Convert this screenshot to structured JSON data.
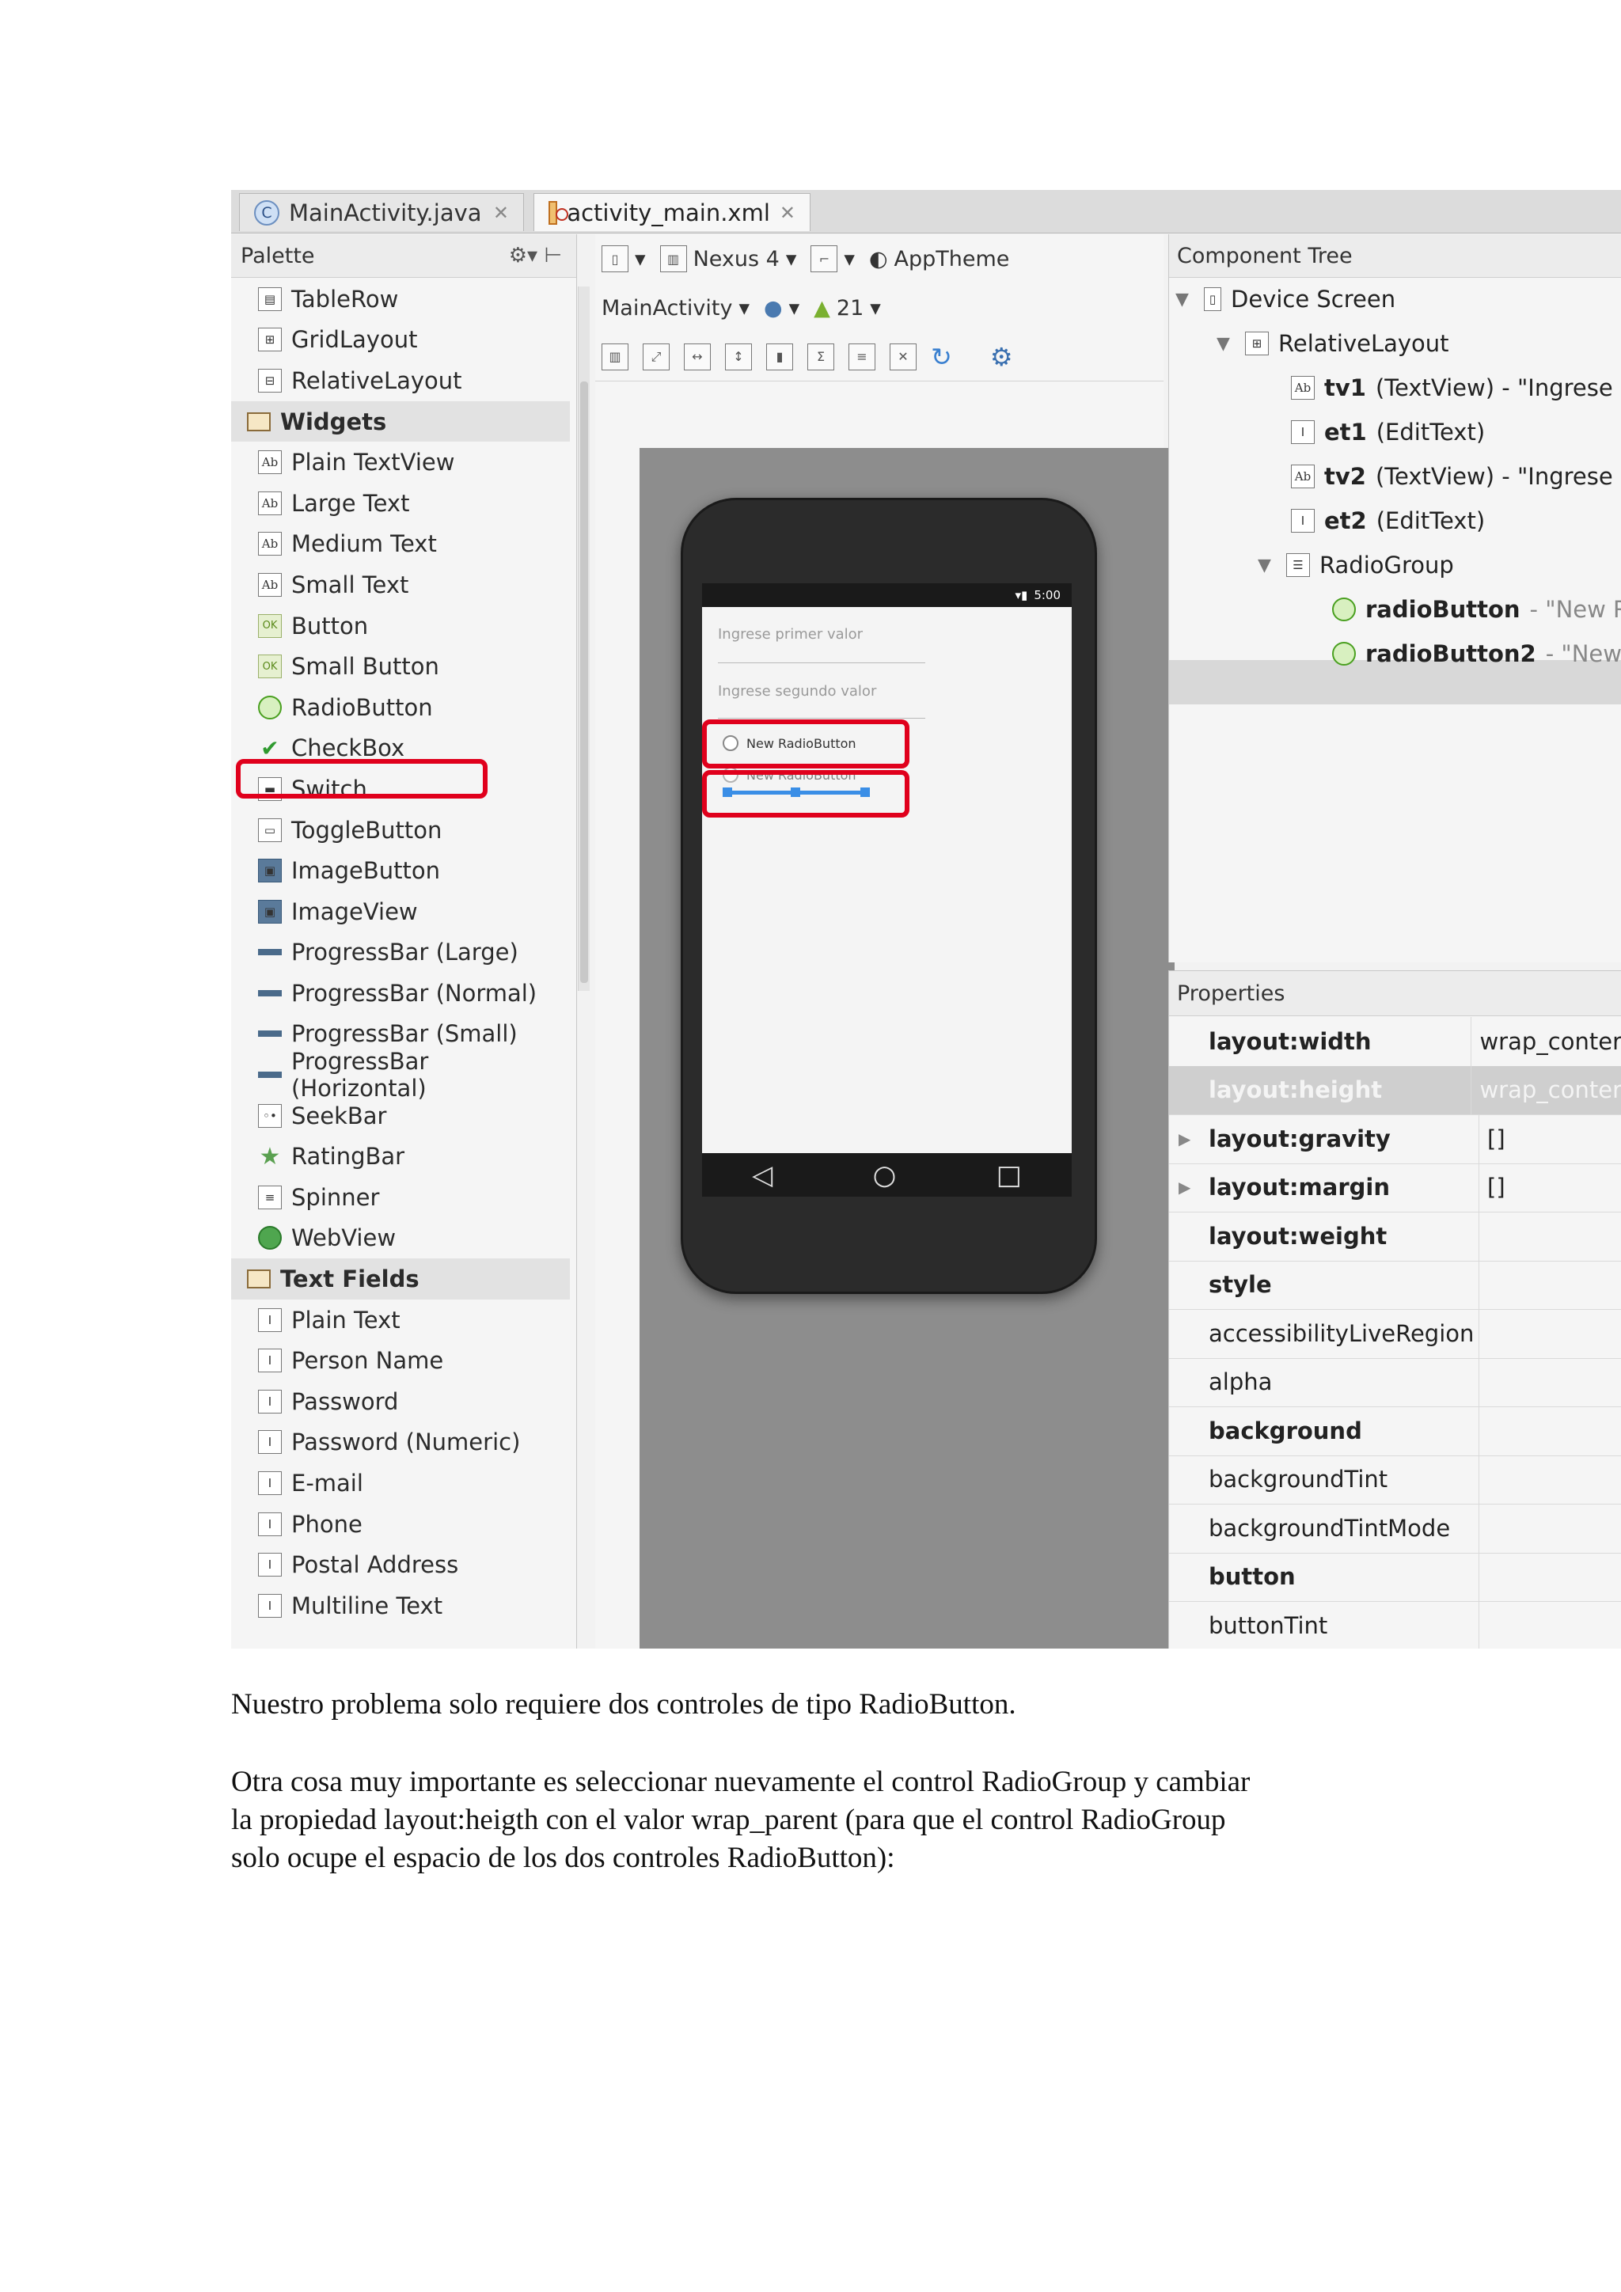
{
  "tabs": [
    {
      "label": "MainActivity.java",
      "icon": "java-class-icon"
    },
    {
      "label": "activity_main.xml",
      "icon": "xml-layout-icon"
    }
  ],
  "palette": {
    "title": "Palette",
    "items": [
      {
        "label": "TableRow",
        "icon": "table-row-icon",
        "kind": "item"
      },
      {
        "label": "GridLayout",
        "icon": "grid-layout-icon",
        "kind": "item"
      },
      {
        "label": "RelativeLayout",
        "icon": "relative-layout-icon",
        "kind": "item"
      },
      {
        "label": "Widgets",
        "icon": "folder-icon",
        "kind": "category"
      },
      {
        "label": "Plain TextView",
        "icon": "textview-icon",
        "kind": "item"
      },
      {
        "label": "Large Text",
        "icon": "textview-icon",
        "kind": "item"
      },
      {
        "label": "Medium Text",
        "icon": "textview-icon",
        "kind": "item"
      },
      {
        "label": "Small Text",
        "icon": "textview-icon",
        "kind": "item"
      },
      {
        "label": "Button",
        "icon": "button-icon",
        "kind": "item"
      },
      {
        "label": "Small Button",
        "icon": "button-icon",
        "kind": "item"
      },
      {
        "label": "RadioButton",
        "icon": "radio-button-icon",
        "kind": "item"
      },
      {
        "label": "CheckBox",
        "icon": "checkbox-icon",
        "kind": "item"
      },
      {
        "label": "Switch",
        "icon": "switch-icon",
        "kind": "item"
      },
      {
        "label": "ToggleButton",
        "icon": "toggle-button-icon",
        "kind": "item"
      },
      {
        "label": "ImageButton",
        "icon": "image-button-icon",
        "kind": "item"
      },
      {
        "label": "ImageView",
        "icon": "image-view-icon",
        "kind": "item"
      },
      {
        "label": "ProgressBar (Large)",
        "icon": "progress-bar-icon",
        "kind": "item"
      },
      {
        "label": "ProgressBar (Normal)",
        "icon": "progress-bar-icon",
        "kind": "item"
      },
      {
        "label": "ProgressBar (Small)",
        "icon": "progress-bar-icon",
        "kind": "item"
      },
      {
        "label": "ProgressBar (Horizontal)",
        "icon": "progress-bar-icon",
        "kind": "item"
      },
      {
        "label": "SeekBar",
        "icon": "seekbar-icon",
        "kind": "item"
      },
      {
        "label": "RatingBar",
        "icon": "star-icon",
        "kind": "item"
      },
      {
        "label": "Spinner",
        "icon": "spinner-icon",
        "kind": "item"
      },
      {
        "label": "WebView",
        "icon": "globe-icon",
        "kind": "item"
      },
      {
        "label": "Text Fields",
        "icon": "folder-icon",
        "kind": "category"
      },
      {
        "label": "Plain Text",
        "icon": "edittext-icon",
        "kind": "item"
      },
      {
        "label": "Person Name",
        "icon": "edittext-icon",
        "kind": "item"
      },
      {
        "label": "Password",
        "icon": "edittext-icon",
        "kind": "item"
      },
      {
        "label": "Password (Numeric)",
        "icon": "edittext-icon",
        "kind": "item"
      },
      {
        "label": "E-mail",
        "icon": "edittext-icon",
        "kind": "item"
      },
      {
        "label": "Phone",
        "icon": "edittext-icon",
        "kind": "item"
      },
      {
        "label": "Postal Address",
        "icon": "edittext-icon",
        "kind": "item"
      },
      {
        "label": "Multiline Text",
        "icon": "edittext-icon",
        "kind": "item"
      }
    ]
  },
  "toolbar": {
    "device": "Nexus 4",
    "theme": "AppTheme",
    "activity": "MainActivity",
    "api": "21"
  },
  "preview": {
    "time": "5:00",
    "hint1": "Ingrese primer valor",
    "hint2": "Ingrese segundo valor",
    "radio1": "New RadioButton",
    "radio2": "New RadioButton"
  },
  "component_tree": {
    "title": "Component Tree",
    "nodes": [
      {
        "name": "Device Screen",
        "detail": "",
        "icon": "device-icon"
      },
      {
        "name": "RelativeLayout",
        "detail": "",
        "icon": "relative-layout-icon"
      },
      {
        "name": "tv1",
        "detail": "(TextView) - \"Ingrese p",
        "icon": "textview-icon"
      },
      {
        "name": "et1",
        "detail": "(EditText)",
        "icon": "edittext-icon"
      },
      {
        "name": "tv2",
        "detail": "(TextView) - \"Ingrese s",
        "icon": "textview-icon"
      },
      {
        "name": "et2",
        "detail": "(EditText)",
        "icon": "edittext-icon"
      },
      {
        "name": "RadioGroup",
        "detail": "",
        "icon": "radio-group-icon"
      },
      {
        "name": "radioButton",
        "detail": "- \"New R",
        "icon": "radio-button-icon"
      },
      {
        "name": "radioButton2",
        "detail": "- \"New",
        "icon": "radio-button-icon"
      }
    ]
  },
  "properties": {
    "title": "Properties",
    "rows": [
      {
        "name": "layout:width",
        "value": "wrap_conter"
      },
      {
        "name": "layout:height",
        "value": "wrap_conter"
      },
      {
        "name": "layout:gravity",
        "value": "[]"
      },
      {
        "name": "layout:margin",
        "value": "[]"
      },
      {
        "name": "layout:weight",
        "value": ""
      },
      {
        "name": "style",
        "value": ""
      },
      {
        "name": "accessibilityLiveRegion",
        "value": ""
      },
      {
        "name": "alpha",
        "value": ""
      },
      {
        "name": "background",
        "value": ""
      },
      {
        "name": "backgroundTint",
        "value": ""
      },
      {
        "name": "backgroundTintMode",
        "value": ""
      },
      {
        "name": "button",
        "value": ""
      },
      {
        "name": "buttonTint",
        "value": ""
      }
    ]
  },
  "document": {
    "p1": "Nuestro problema solo requiere dos controles de tipo RadioButton.",
    "p2_line1": "Otra cosa muy importante es seleccionar nuevamente el control RadioGroup y cambiar",
    "p2_line2": "la propiedad layout:heigth con el valor wrap_parent (para que el control RadioGroup",
    "p2_line3": "solo ocupe el espacio de los dos controles RadioButton):"
  },
  "colors": {
    "highlight": "#e0001c",
    "selection": "#3a8ee6"
  }
}
